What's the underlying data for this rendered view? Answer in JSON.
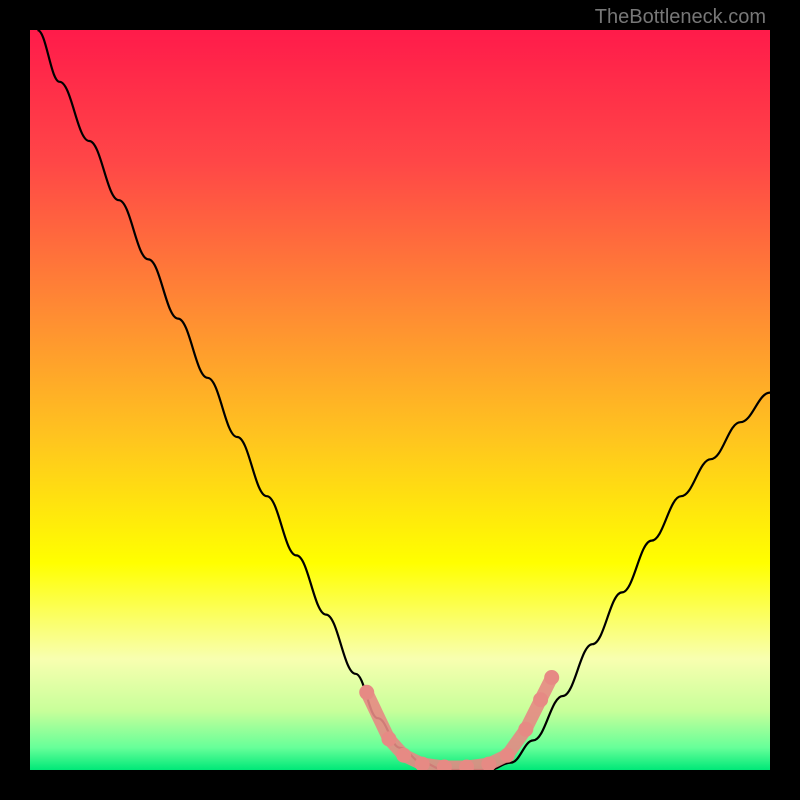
{
  "watermark": "TheBottleneck.com",
  "chart_data": {
    "type": "line",
    "title": "",
    "xlabel": "",
    "ylabel": "",
    "xlim": [
      0,
      100
    ],
    "ylim": [
      0,
      100
    ],
    "gradient_stops": [
      {
        "offset": 0,
        "color": "#ff1b4a"
      },
      {
        "offset": 0.18,
        "color": "#ff4747"
      },
      {
        "offset": 0.38,
        "color": "#ff8b33"
      },
      {
        "offset": 0.55,
        "color": "#ffc41f"
      },
      {
        "offset": 0.72,
        "color": "#ffff00"
      },
      {
        "offset": 0.85,
        "color": "#f8ffb0"
      },
      {
        "offset": 0.92,
        "color": "#c8ff9a"
      },
      {
        "offset": 0.97,
        "color": "#66ff99"
      },
      {
        "offset": 1.0,
        "color": "#00e878"
      }
    ],
    "series": [
      {
        "name": "bottleneck-curve",
        "color": "#000000",
        "x": [
          1,
          4,
          8,
          12,
          16,
          20,
          24,
          28,
          32,
          36,
          40,
          44,
          47,
          50,
          53,
          56,
          59,
          62,
          65,
          68,
          72,
          76,
          80,
          84,
          88,
          92,
          96,
          100
        ],
        "y": [
          100,
          93,
          85,
          77,
          69,
          61,
          53,
          45,
          37,
          29,
          21,
          13,
          7,
          3,
          1,
          0,
          0,
          0,
          1,
          4,
          10,
          17,
          24,
          31,
          37,
          42,
          47,
          51
        ]
      }
    ],
    "markers": {
      "name": "highlight-dots",
      "color": "#e68a84",
      "points": [
        {
          "x": 45.5,
          "y": 10.5
        },
        {
          "x": 48.5,
          "y": 4.2
        },
        {
          "x": 50.5,
          "y": 2.0
        },
        {
          "x": 53.0,
          "y": 0.8
        },
        {
          "x": 56.0,
          "y": 0.4
        },
        {
          "x": 59.0,
          "y": 0.4
        },
        {
          "x": 62.0,
          "y": 0.8
        },
        {
          "x": 64.5,
          "y": 2.0
        },
        {
          "x": 67.0,
          "y": 5.5
        },
        {
          "x": 69.0,
          "y": 9.5
        },
        {
          "x": 70.5,
          "y": 12.5
        }
      ]
    }
  }
}
